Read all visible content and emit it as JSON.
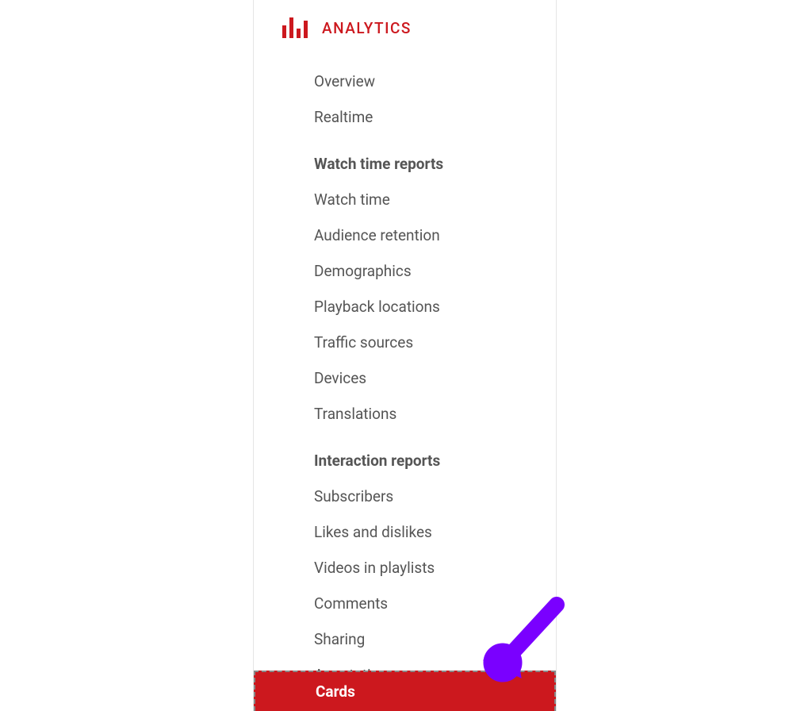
{
  "sidebar": {
    "title": "ANALYTICS",
    "top_items": [
      {
        "label": "Overview"
      },
      {
        "label": "Realtime"
      }
    ],
    "groups": [
      {
        "header": "Watch time reports",
        "items": [
          {
            "label": "Watch time"
          },
          {
            "label": "Audience retention"
          },
          {
            "label": "Demographics"
          },
          {
            "label": "Playback locations"
          },
          {
            "label": "Traffic sources"
          },
          {
            "label": "Devices"
          },
          {
            "label": "Translations"
          }
        ]
      },
      {
        "header": "Interaction reports",
        "items": [
          {
            "label": "Subscribers"
          },
          {
            "label": "Likes and dislikes"
          },
          {
            "label": "Videos in playlists"
          },
          {
            "label": "Comments"
          },
          {
            "label": "Sharing"
          },
          {
            "label": "Annotations"
          }
        ]
      }
    ],
    "selected": {
      "label": "Cards"
    }
  },
  "colors": {
    "accent": "#cc181e",
    "annotation_arrow": "#7a00ff"
  }
}
